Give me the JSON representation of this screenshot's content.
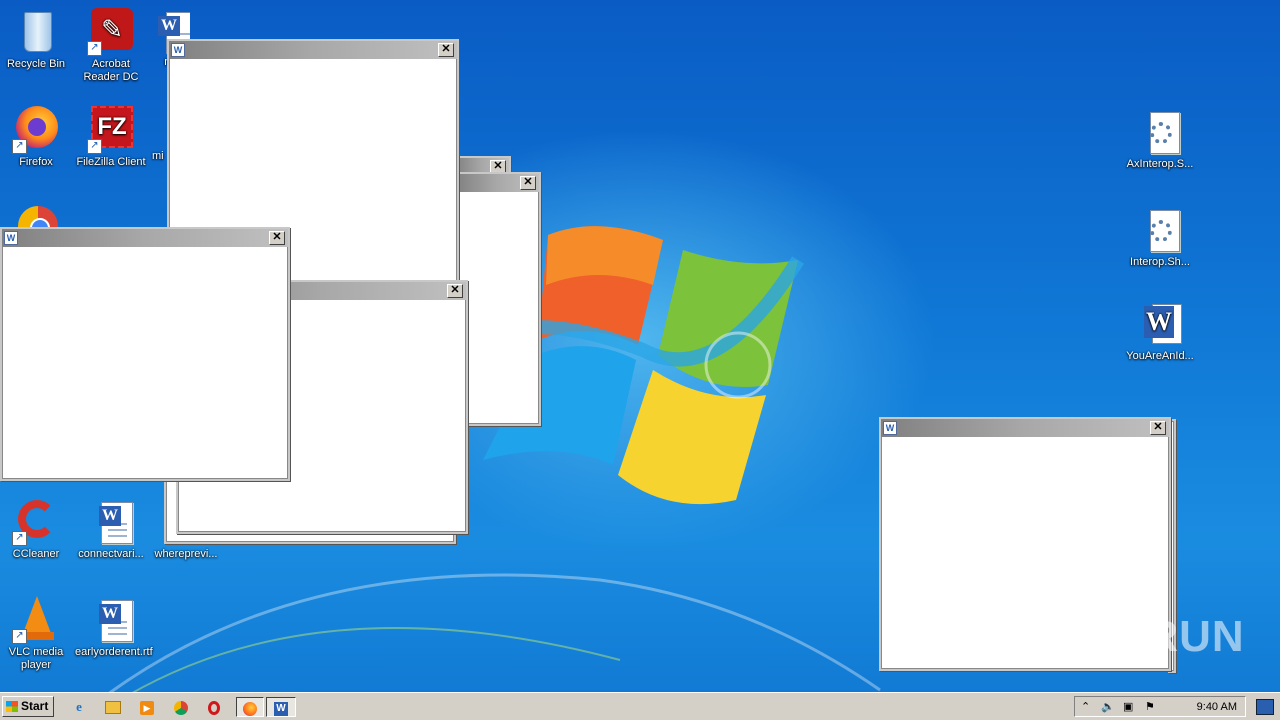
{
  "desktop_icons": {
    "recycle_bin": "Recycle Bin",
    "acrobat": "Acrobat Reader DC",
    "word_doc_top": "mi",
    "firefox": "Firefox",
    "filezilla": "FileZilla Client",
    "partial_mi": "mi",
    "ccleaner": "CCleaner",
    "connectvari": "connectvari...",
    "whereprevi": "whereprevi...",
    "vlc": "VLC media player",
    "earlyorder": "earlyorderent.rtf",
    "axinterop": "AxInterop.S...",
    "interop": "Interop.Sh...",
    "youareanid": "YouAreAnId..."
  },
  "window_close_glyph": "✕",
  "taskbar": {
    "start_label": "Start",
    "clock": "9:40 AM"
  },
  "watermark": "ANY RUN",
  "colors": {
    "desktop_blue": "#1078d6",
    "titlebar_gray": "#a8a8a8",
    "taskbar_gray": "#d4d0c8"
  },
  "icons": [
    "recycle-bin-icon",
    "acrobat-icon",
    "word-doc-icon",
    "firefox-icon",
    "filezilla-icon",
    "chrome-icon",
    "ccleaner-icon",
    "vlc-icon",
    "settings-file-icon",
    "word-icon",
    "ie-icon",
    "explorer-icon",
    "media-player-icon",
    "opera-icon",
    "show-desktop-icon"
  ]
}
